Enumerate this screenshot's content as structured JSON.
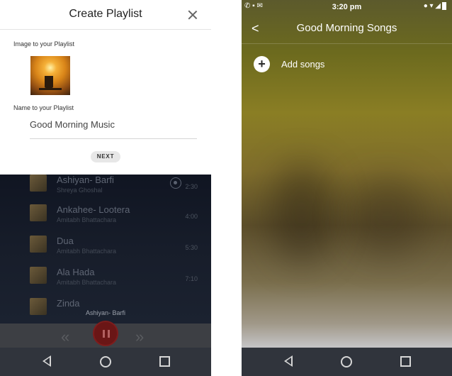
{
  "left_screen": {
    "modal": {
      "title": "Create Playlist",
      "close_icon": "close-icon",
      "image_label": "Image to your Playlist",
      "name_label": "Name to your Playlist",
      "name_value": "Good Morning Music",
      "next_label": "NEXT"
    },
    "songs": [
      {
        "title": "Ashiyan- Barfi",
        "artist": "Shreya Ghoshal",
        "duration": "2:30"
      },
      {
        "title": "Ankahee- Lootera",
        "artist": "Amitabh Bhattachara",
        "duration": "4:00"
      },
      {
        "title": "Dua",
        "artist": "Amitabh Bhattachara",
        "duration": "5:30"
      },
      {
        "title": "Ala Hada",
        "artist": "Amitabh Bhattachara",
        "duration": "7:10"
      },
      {
        "title": "Zinda",
        "artist": "",
        "duration": ""
      }
    ],
    "now_playing": "Ashiyan- Barfi",
    "player_icons": {
      "prev": "rewind-icon",
      "pause": "pause-icon",
      "next": "forward-icon"
    }
  },
  "right_screen": {
    "status_bar": {
      "time": "3:20 pm",
      "left_icons": "phone-icon message-icon mail-icon",
      "right_icons": "location-icon wifi-icon signal-icon battery-icon"
    },
    "title": "Good Morning Songs",
    "add_songs_label": "Add songs"
  },
  "nav_icons": [
    "back-icon",
    "home-icon",
    "recents-icon"
  ],
  "colors": {
    "modal_bg": "#ffffff",
    "nav_bg": "#30343c",
    "pause_button": "#6a1616"
  }
}
